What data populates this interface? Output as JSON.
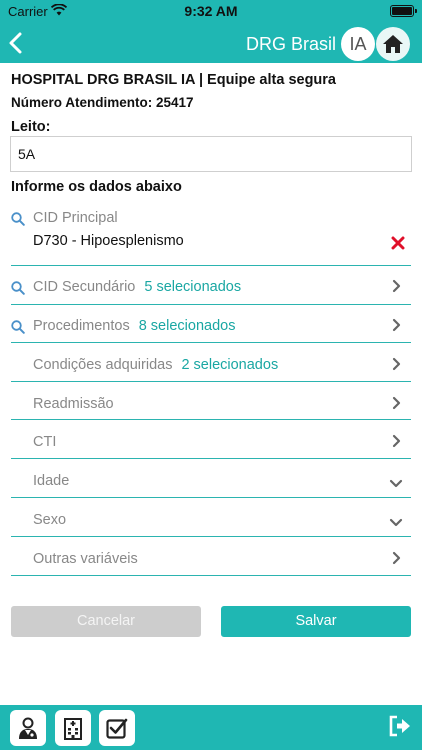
{
  "status_bar": {
    "carrier": "Carrier",
    "time": "9:32 AM"
  },
  "nav": {
    "title": "DRG Brasil",
    "ia_badge": "IA"
  },
  "header": {
    "hospital": "HOSPITAL DRG BRASIL IA | Equipe alta segura",
    "atendimento": "Número Atendimento: 25417"
  },
  "leito": {
    "label": "Leito:",
    "value": "5A"
  },
  "form": {
    "title": "Informe os dados abaixo",
    "cid_principal": {
      "label": "CID Principal",
      "value": "D730 - Hipoesplenismo"
    },
    "cid_secundario": {
      "label": "CID Secundário",
      "count": "5 selecionados"
    },
    "procedimentos": {
      "label": "Procedimentos",
      "count": "8 selecionados"
    },
    "condicoes": {
      "label": "Condições adquiridas",
      "count": "2 selecionados"
    },
    "readmissao": {
      "label": "Readmissão"
    },
    "cti": {
      "label": "CTI"
    },
    "idade": {
      "label": "Idade"
    },
    "sexo": {
      "label": "Sexo"
    },
    "outras": {
      "label": "Outras variáveis"
    }
  },
  "actions": {
    "cancel": "Cancelar",
    "save": "Salvar"
  },
  "colors": {
    "accent": "#1fb7b3",
    "remove": "#e0102a",
    "muted": "#888888"
  }
}
